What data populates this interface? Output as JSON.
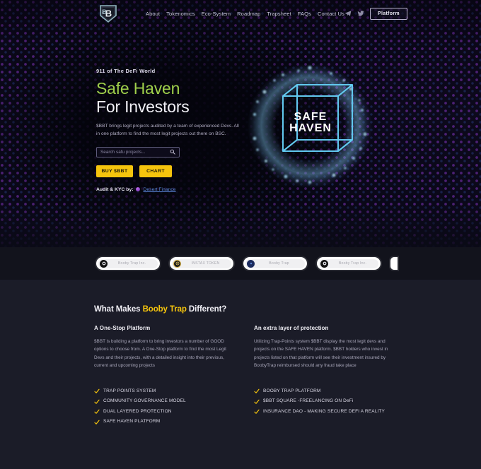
{
  "colors": {
    "accent_yellow": "#f5c40d",
    "hero_green": "#9fcf4b",
    "link_blue": "#5a84d6",
    "cube_cyan": "#6fd4f5",
    "lower_bg": "#1b1c28"
  },
  "nav": {
    "logo_alt": "Booby Trap shield logo",
    "links": [
      {
        "label": "About"
      },
      {
        "label": "Tokenomics"
      },
      {
        "label": "Eco-System"
      },
      {
        "label": "Roadmap"
      },
      {
        "label": "Trapsheet"
      },
      {
        "label": "FAQs"
      },
      {
        "label": "Contact Us"
      }
    ],
    "socials": [
      {
        "name": "telegram-icon"
      },
      {
        "name": "twitter-icon"
      }
    ],
    "platform_button": "Platform"
  },
  "hero": {
    "eyebrow": "911 of The DeFi World",
    "title_line1": "Safe Haven",
    "title_line2": "For Investors",
    "paragraph": "$BBT brings legit projects audited by a team of experienced Devs. All in one platform to find the most legit projects out there on BSC.",
    "search_placeholder": "Search safu projects...",
    "search_value": "",
    "buttons": [
      {
        "label": "BUY $BBT"
      },
      {
        "label": "CHART"
      }
    ],
    "audit_label": "Audit & KYC by:",
    "audit_link": "Desert Finance",
    "cube_text_line1": "SAFE",
    "cube_text_line2": "HAVEN"
  },
  "partners": {
    "cards": [
      {
        "label": "Booby Trap Inc.",
        "logo": "booby-trap-logo"
      },
      {
        "label": "INSTAX TOKEN",
        "logo": "instax-token-logo"
      },
      {
        "label": "Booby Trap",
        "logo": "booby-trap-logo"
      },
      {
        "label": "Booby Trap Inc.",
        "logo": "booby-trap-logo"
      }
    ]
  },
  "about": {
    "heading_before": "What Makes ",
    "heading_highlight": "Booby Trap",
    "heading_after": " Different?",
    "columns": [
      {
        "title": "A One-Stop Platform",
        "body": "$BBT is building a platform to bring investors a number of GOOD options to choose from. A One-Stop platform to find the most Legit Devs and their projects, with a detailed insight into their previous, current and upcoming projects"
      },
      {
        "title": "An extra layer of protection",
        "body": "Utilizing Trap-Points system $BBT display the most legit devs and projects on the SAFE HAVEN platform. $BBT holders who invest in projects listed on that platform will see their investment insured by BoobyTrap reimbursed should any fraud take place"
      }
    ],
    "features_left": [
      {
        "label": "TRAP POINTS SYSTEM"
      },
      {
        "label": "COMMUNITY GOVERNANCE MODEL"
      },
      {
        "label": "DUAL LAYERED PROTECTION"
      },
      {
        "label": "SAFE HAVEN PLATFORM"
      }
    ],
    "features_right": [
      {
        "label": "BOOBY TRAP PLATFORM"
      },
      {
        "label": "$BBT SQUARE -FREELANCING ON DeFi"
      },
      {
        "label": "INSURANCE DAO - MAKING SECURE DEFI A REALITY"
      }
    ]
  }
}
